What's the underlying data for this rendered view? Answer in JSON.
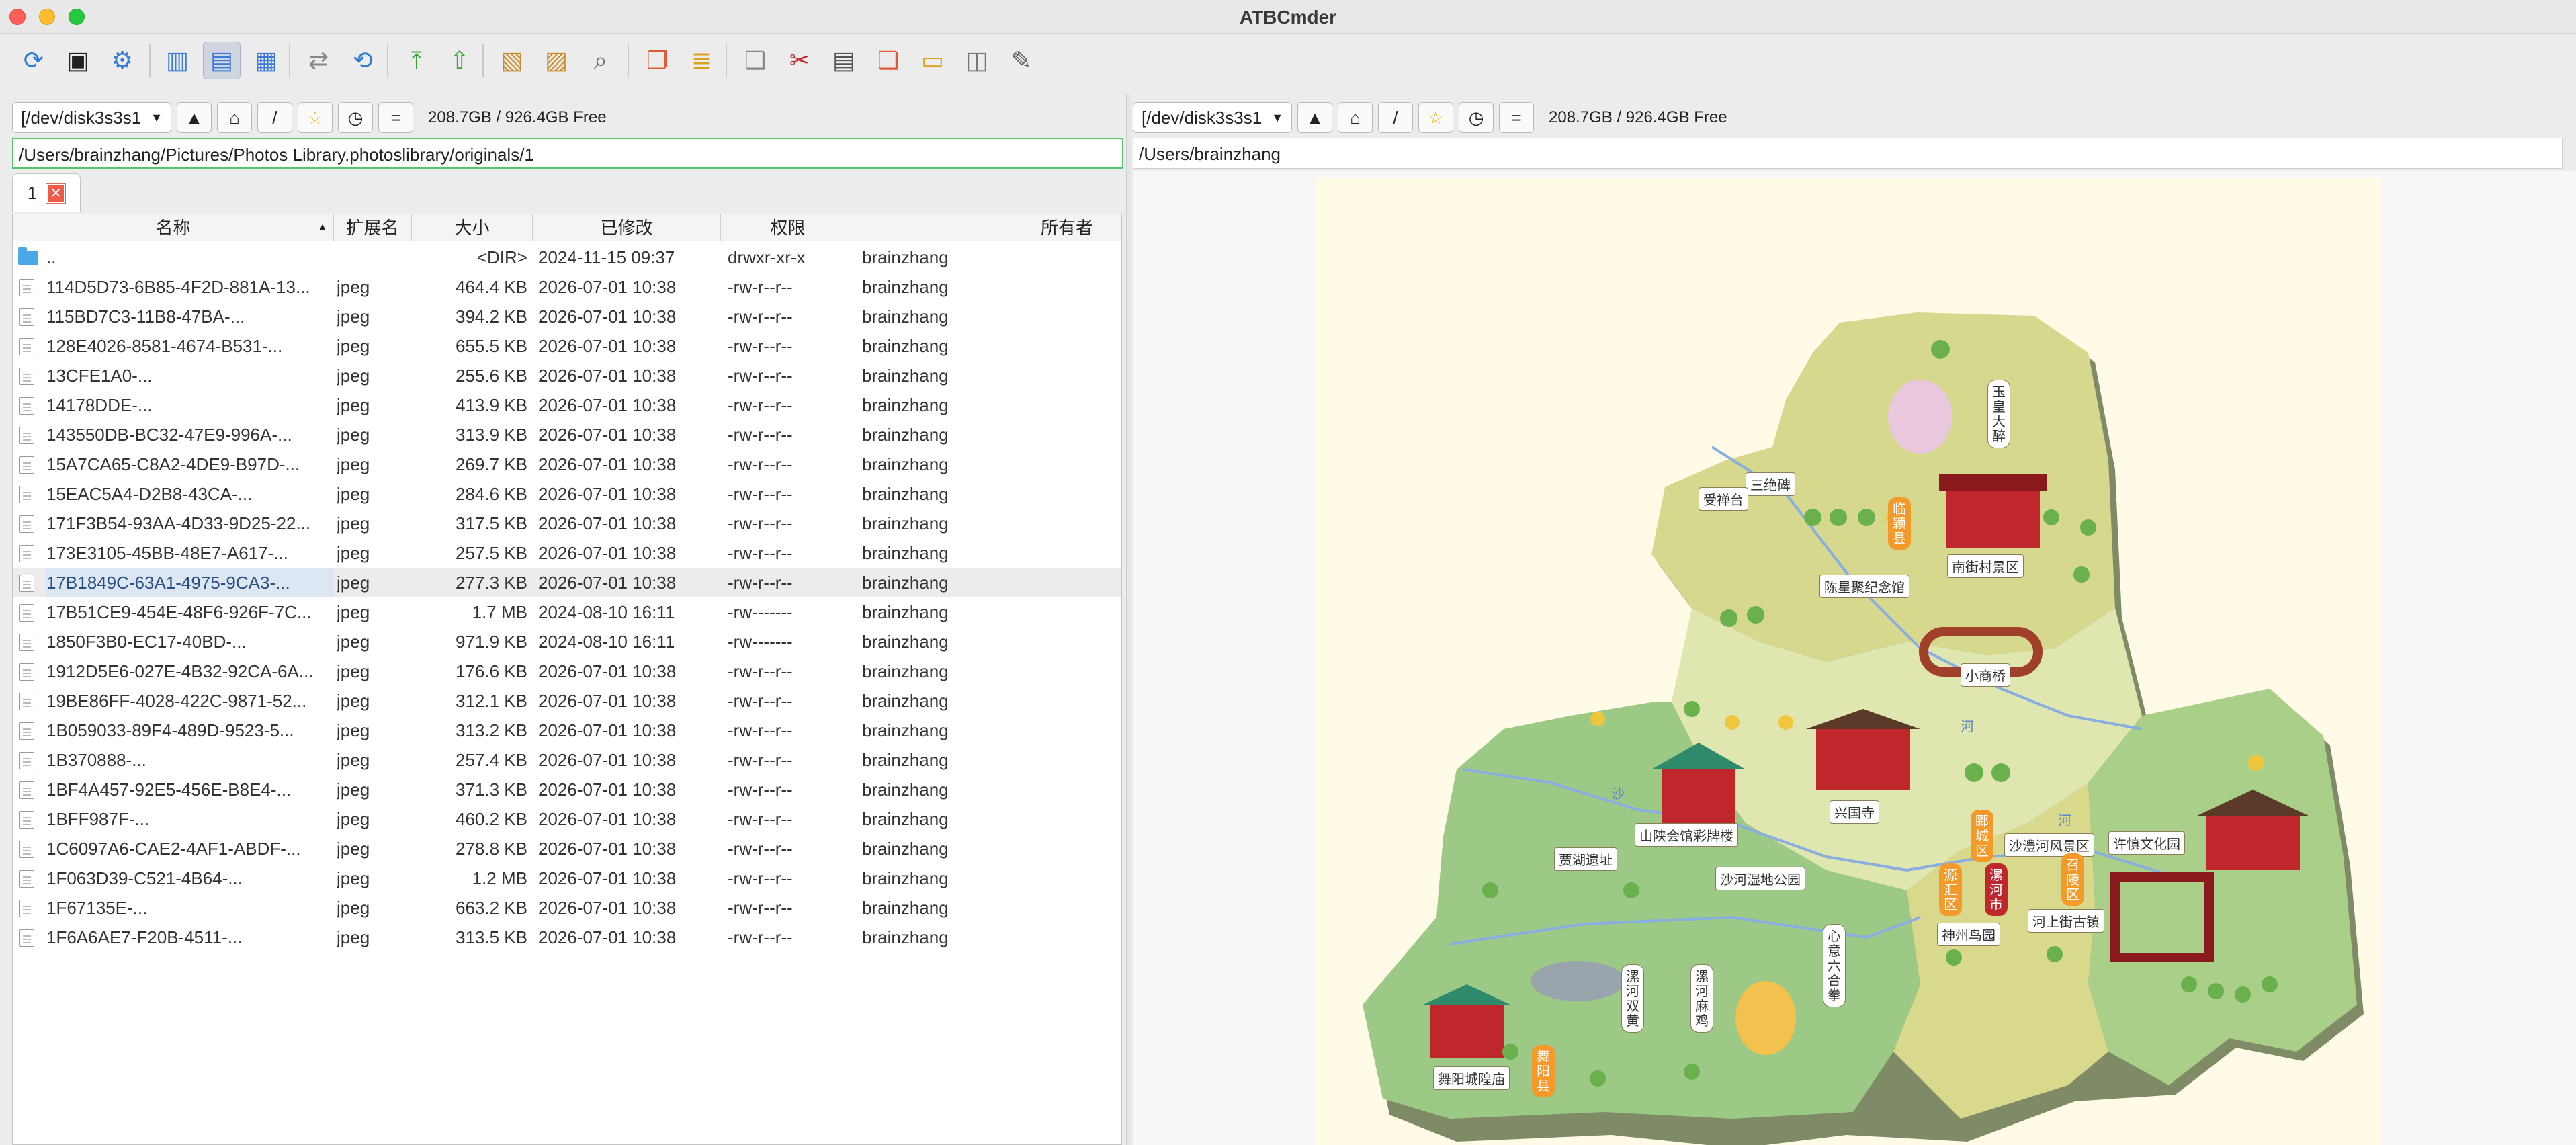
{
  "window": {
    "title": "ATBCmder"
  },
  "toolbar": {
    "buttons": [
      {
        "name": "refresh-icon",
        "glyph": "⟳",
        "color": "#2e7bd6"
      },
      {
        "name": "terminal-icon",
        "glyph": "▣",
        "color": "#222"
      },
      {
        "name": "settings-icon",
        "glyph": "⚙",
        "color": "#3a7bd5"
      },
      {
        "name": "brief-view-icon",
        "glyph": "▥",
        "color": "#3a7bd5"
      },
      {
        "name": "detail-view-icon",
        "glyph": "▤",
        "color": "#3a7bd5"
      },
      {
        "name": "thumbnail-view-icon",
        "glyph": "▦",
        "color": "#3a7bd5"
      },
      {
        "name": "compare-dirs-icon",
        "glyph": "⇄",
        "color": "#888"
      },
      {
        "name": "sync-dirs-icon",
        "glyph": "⟲",
        "color": "#2e7bd6"
      },
      {
        "name": "goto-root-icon",
        "glyph": "⤒",
        "color": "#3aa53a"
      },
      {
        "name": "goto-parent-icon",
        "glyph": "⇧",
        "color": "#3aa53a"
      },
      {
        "name": "pack-icon",
        "glyph": "▧",
        "color": "#c98a2a"
      },
      {
        "name": "unpack-icon",
        "glyph": "▨",
        "color": "#c98a2a"
      },
      {
        "name": "find-icon",
        "glyph": "⌕",
        "color": "#666"
      },
      {
        "name": "copy-icon",
        "glyph": "❐",
        "color": "#e05a3a"
      },
      {
        "name": "move-icon",
        "glyph": "≣",
        "color": "#d9a21a"
      },
      {
        "name": "duplicate-icon",
        "glyph": "❑",
        "color": "#888"
      },
      {
        "name": "cut-icon",
        "glyph": "✂",
        "color": "#c0272d"
      },
      {
        "name": "delete-icon",
        "glyph": "▤",
        "color": "#555"
      },
      {
        "name": "paste-icon",
        "glyph": "❏",
        "color": "#e05a3a"
      },
      {
        "name": "new-folder-icon",
        "glyph": "▭",
        "color": "#d9a21a"
      },
      {
        "name": "properties-icon",
        "glyph": "◫",
        "color": "#777"
      },
      {
        "name": "edit-icon",
        "glyph": "✎",
        "color": "#555"
      }
    ]
  },
  "left": {
    "drive": "[/dev/disk3s3s1",
    "free": "208.7GB / 926.4GB Free",
    "path": "/Users/brainzhang/Pictures/Photos Library.photoslibrary/originals/1",
    "tab_label": "1",
    "columns": {
      "name": "名称",
      "ext": "扩展名",
      "size": "大小",
      "modified": "已修改",
      "perm": "权限",
      "owner": "所有者"
    },
    "rows": [
      {
        "name": "..",
        "ext": "",
        "size": "<DIR>",
        "modified": "2024-11-15 09:37",
        "perm": "drwxr-xr-x",
        "owner": "brainzhang",
        "dir": true
      },
      {
        "name": "114D5D73-6B85-4F2D-881A-13...",
        "ext": "jpeg",
        "size": "464.4 KB",
        "modified": "2026-07-01 10:38",
        "perm": "-rw-r--r--",
        "owner": "brainzhang"
      },
      {
        "name": "115BD7C3-11B8-47BA-...",
        "ext": "jpeg",
        "size": "394.2 KB",
        "modified": "2026-07-01 10:38",
        "perm": "-rw-r--r--",
        "owner": "brainzhang"
      },
      {
        "name": "128E4026-8581-4674-B531-...",
        "ext": "jpeg",
        "size": "655.5 KB",
        "modified": "2026-07-01 10:38",
        "perm": "-rw-r--r--",
        "owner": "brainzhang"
      },
      {
        "name": "13CFE1A0-...",
        "ext": "jpeg",
        "size": "255.6 KB",
        "modified": "2026-07-01 10:38",
        "perm": "-rw-r--r--",
        "owner": "brainzhang"
      },
      {
        "name": "14178DDE-...",
        "ext": "jpeg",
        "size": "413.9 KB",
        "modified": "2026-07-01 10:38",
        "perm": "-rw-r--r--",
        "owner": "brainzhang"
      },
      {
        "name": "143550DB-BC32-47E9-996A-...",
        "ext": "jpeg",
        "size": "313.9 KB",
        "modified": "2026-07-01 10:38",
        "perm": "-rw-r--r--",
        "owner": "brainzhang"
      },
      {
        "name": "15A7CA65-C8A2-4DE9-B97D-...",
        "ext": "jpeg",
        "size": "269.7 KB",
        "modified": "2026-07-01 10:38",
        "perm": "-rw-r--r--",
        "owner": "brainzhang"
      },
      {
        "name": "15EAC5A4-D2B8-43CA-...",
        "ext": "jpeg",
        "size": "284.6 KB",
        "modified": "2026-07-01 10:38",
        "perm": "-rw-r--r--",
        "owner": "brainzhang"
      },
      {
        "name": "171F3B54-93AA-4D33-9D25-22...",
        "ext": "jpeg",
        "size": "317.5 KB",
        "modified": "2026-07-01 10:38",
        "perm": "-rw-r--r--",
        "owner": "brainzhang"
      },
      {
        "name": "173E3105-45BB-48E7-A617-...",
        "ext": "jpeg",
        "size": "257.5 KB",
        "modified": "2026-07-01 10:38",
        "perm": "-rw-r--r--",
        "owner": "brainzhang"
      },
      {
        "name": "17B1849C-63A1-4975-9CA3-...",
        "ext": "jpeg",
        "size": "277.3 KB",
        "modified": "2026-07-01 10:38",
        "perm": "-rw-r--r--",
        "owner": "brainzhang",
        "selected": true
      },
      {
        "name": "17B51CE9-454E-48F6-926F-7C...",
        "ext": "jpeg",
        "size": "1.7 MB",
        "modified": "2024-08-10 16:11",
        "perm": "-rw-------",
        "owner": "brainzhang"
      },
      {
        "name": "1850F3B0-EC17-40BD-...",
        "ext": "jpeg",
        "size": "971.9 KB",
        "modified": "2024-08-10 16:11",
        "perm": "-rw-------",
        "owner": "brainzhang"
      },
      {
        "name": "1912D5E6-027E-4B32-92CA-6A...",
        "ext": "jpeg",
        "size": "176.6 KB",
        "modified": "2026-07-01 10:38",
        "perm": "-rw-r--r--",
        "owner": "brainzhang"
      },
      {
        "name": "19BE86FF-4028-422C-9871-52...",
        "ext": "jpeg",
        "size": "312.1 KB",
        "modified": "2026-07-01 10:38",
        "perm": "-rw-r--r--",
        "owner": "brainzhang"
      },
      {
        "name": "1B059033-89F4-489D-9523-5...",
        "ext": "jpeg",
        "size": "313.2 KB",
        "modified": "2026-07-01 10:38",
        "perm": "-rw-r--r--",
        "owner": "brainzhang"
      },
      {
        "name": "1B370888-...",
        "ext": "jpeg",
        "size": "257.4 KB",
        "modified": "2026-07-01 10:38",
        "perm": "-rw-r--r--",
        "owner": "brainzhang"
      },
      {
        "name": "1BF4A457-92E5-456E-B8E4-...",
        "ext": "jpeg",
        "size": "371.3 KB",
        "modified": "2026-07-01 10:38",
        "perm": "-rw-r--r--",
        "owner": "brainzhang"
      },
      {
        "name": "1BFF987F-...",
        "ext": "jpeg",
        "size": "460.2 KB",
        "modified": "2026-07-01 10:38",
        "perm": "-rw-r--r--",
        "owner": "brainzhang"
      },
      {
        "name": "1C6097A6-CAE2-4AF1-ABDF-...",
        "ext": "jpeg",
        "size": "278.8 KB",
        "modified": "2026-07-01 10:38",
        "perm": "-rw-r--r--",
        "owner": "brainzhang"
      },
      {
        "name": "1F063D39-C521-4B64-...",
        "ext": "jpeg",
        "size": "1.2 MB",
        "modified": "2026-07-01 10:38",
        "perm": "-rw-r--r--",
        "owner": "brainzhang"
      },
      {
        "name": "1F67135E-...",
        "ext": "jpeg",
        "size": "663.2 KB",
        "modified": "2026-07-01 10:38",
        "perm": "-rw-r--r--",
        "owner": "brainzhang"
      },
      {
        "name": "1F6A6AE7-F20B-4511-...",
        "ext": "jpeg",
        "size": "313.5 KB",
        "modified": "2026-07-01 10:38",
        "perm": "-rw-r--r--",
        "owner": "brainzhang"
      }
    ]
  },
  "right": {
    "drive": "[/dev/disk3s3s1",
    "free": "208.7GB / 926.4GB Free",
    "path": "/Users/brainzhang",
    "map_labels": {
      "yuhuang": "玉皇大醉",
      "sanjuebei": "三绝碑",
      "aichantai": "受禅台",
      "linying": "临颖县",
      "nanjiecun": "南街村景区",
      "chenxingju": "陈星聚纪念馆",
      "xiaoshangqiao": "小商桥",
      "xingguosi": "兴国寺",
      "shanshan": "山陕会馆彩牌楼",
      "jiahu": "贾湖遗址",
      "shahe": "沙河湿地公园",
      "yancheng": "郾城区",
      "yuanhui": "源汇区",
      "luohe": "漯河市",
      "shaluoqu": "沙澧河风景区",
      "shaoling": "召陵区",
      "xushen": "许慎文化园",
      "heshang": "河上街古镇",
      "shenzhou": "神州鸟园",
      "xinyi": "心意六合拳",
      "luohechuanrou": "漯河双黄",
      "luohemaji": "漯河麻鸡",
      "wuyang": "舞阳县",
      "wuyangcity": "舞阳城隍庙",
      "river1": "河",
      "river2": "沙",
      "river3": "河"
    }
  }
}
